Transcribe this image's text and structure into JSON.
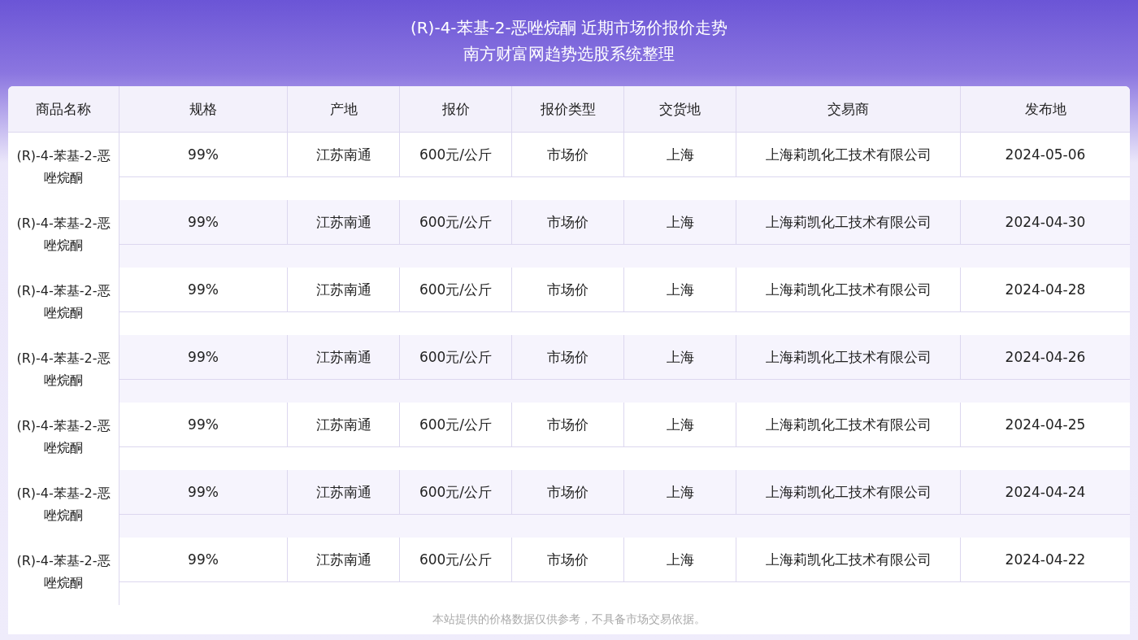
{
  "header": {
    "title": "(R)-4-苯基-2-恶唑烷酮 近期市场价报价走势",
    "subtitle": "南方财富网趋势选股系统整理"
  },
  "table": {
    "columns": [
      "商品名称",
      "规格",
      "产地",
      "报价",
      "报价类型",
      "交货地",
      "交易商",
      "发布地"
    ],
    "rows": [
      [
        "(R)-4-苯基-2-恶唑烷酮",
        "99%",
        "江苏南通",
        "600元/公斤",
        "市场价",
        "上海",
        "上海莉凯化工技术有限公司",
        "2024-05-06"
      ],
      [
        "(R)-4-苯基-2-恶唑烷酮",
        "99%",
        "江苏南通",
        "600元/公斤",
        "市场价",
        "上海",
        "上海莉凯化工技术有限公司",
        "2024-04-30"
      ],
      [
        "(R)-4-苯基-2-恶唑烷酮",
        "99%",
        "江苏南通",
        "600元/公斤",
        "市场价",
        "上海",
        "上海莉凯化工技术有限公司",
        "2024-04-28"
      ],
      [
        "(R)-4-苯基-2-恶唑烷酮",
        "99%",
        "江苏南通",
        "600元/公斤",
        "市场价",
        "上海",
        "上海莉凯化工技术有限公司",
        "2024-04-26"
      ],
      [
        "(R)-4-苯基-2-恶唑烷酮",
        "99%",
        "江苏南通",
        "600元/公斤",
        "市场价",
        "上海",
        "上海莉凯化工技术有限公司",
        "2024-04-25"
      ],
      [
        "(R)-4-苯基-2-恶唑烷酮",
        "99%",
        "江苏南通",
        "600元/公斤",
        "市场价",
        "上海",
        "上海莉凯化工技术有限公司",
        "2024-04-24"
      ],
      [
        "(R)-4-苯基-2-恶唑烷酮",
        "99%",
        "江苏南通",
        "600元/公斤",
        "市场价",
        "上海",
        "上海莉凯化工技术有限公司",
        "2024-04-22"
      ]
    ]
  },
  "footer": {
    "note": "本站提供的价格数据仅供参考，不具备市场交易依据。"
  }
}
